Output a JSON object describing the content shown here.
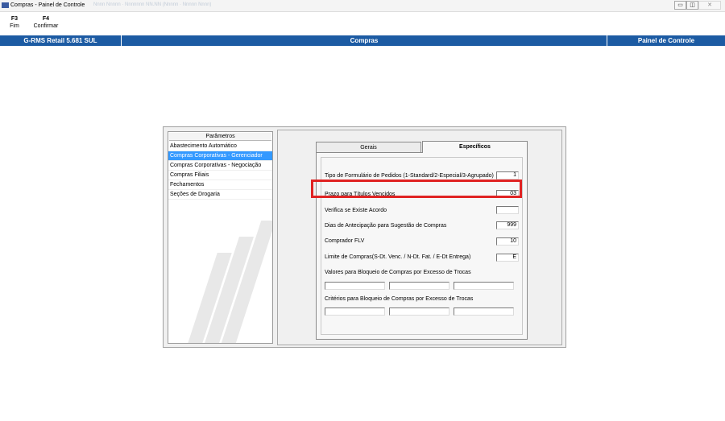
{
  "window": {
    "title": "Compras - Painel de Controle",
    "blurred_text": "Nnnn Nnnnn · Nnnnnnn NN.NN (Nnnnn · Nnnnn Nnnn)",
    "controls": {
      "minimize": "▭",
      "maximize": "◫",
      "close": "✕"
    }
  },
  "toolbar": {
    "keys": [
      {
        "key": "F3",
        "label": "Fim"
      },
      {
        "key": "F4",
        "label": "Confirmar"
      }
    ]
  },
  "header": {
    "left": "G-RMS Retail 5.681 SUL",
    "center": "Compras",
    "right": "Painel de Controle"
  },
  "sidebar": {
    "title": "Parâmetros",
    "items": [
      {
        "label": "Abastecimento Automático"
      },
      {
        "label": "Compras Corporativas - Gerenciador",
        "selected": true
      },
      {
        "label": "Compras Corporativas - Negociação"
      },
      {
        "label": "Compras Filiais"
      },
      {
        "label": "Fechamentos"
      },
      {
        "label": "Seções de Drogaria"
      }
    ]
  },
  "tabs": [
    {
      "label": "Gerais"
    },
    {
      "label": "Específicos",
      "active": true
    }
  ],
  "fields": {
    "tipo_formulario": {
      "label": "Tipo de Formulário de Pedidos (1-Standard/2-Especial/3-Agrupado)",
      "value": "1"
    },
    "prazo_titulos": {
      "label": "Prazo para Títulos Vencidos",
      "value": "03"
    },
    "verifica_acordo": {
      "label": "Verifica se Existe Acordo",
      "value": ""
    },
    "dias_antecipacao": {
      "label": "Dias de Antecipação para Sugestão de Compras",
      "value": "999"
    },
    "comprador_flv": {
      "label": "Comprador FLV",
      "value": "10"
    },
    "limite_compras": {
      "label": "Limite de Compras(S-Dt. Venc. / N-Dt.  Fat. / E-Dt Entrega)",
      "value": "E"
    },
    "valores_bloqueio": {
      "label": "Valores para Bloqueio de Compras por Excesso de Trocas",
      "values": [
        "",
        "",
        ""
      ]
    },
    "criterios_bloqueio": {
      "label": "Critérios para Bloqueio de Compras por Excesso de Trocas",
      "values": [
        "",
        "",
        ""
      ]
    }
  },
  "colors": {
    "header_blue": "#1c5ba3",
    "selection": "#3399ff",
    "highlight": "#e02323"
  }
}
